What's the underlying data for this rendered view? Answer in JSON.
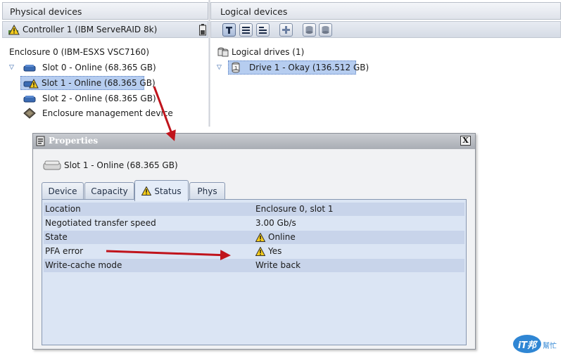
{
  "physical": {
    "header": "Physical devices",
    "controller": "Controller 1 (IBM ServeRAID 8k)",
    "enclosure": "Enclosure 0 (IBM-ESXS VSC7160)",
    "slots": [
      "Slot 0 - Online (68.365 GB)",
      "Slot 1 - Online (68.365 GB)",
      "Slot 2 - Online (68.365 GB)"
    ],
    "management": "Enclosure management device"
  },
  "logical": {
    "header": "Logical devices",
    "group": "Logical drives (1)",
    "drive": "Drive 1 - Okay (136.512 GB)"
  },
  "dialog": {
    "title": "Properties",
    "device": "Slot 1 - Online (68.365 GB)",
    "close": "X",
    "tabs": [
      "Device",
      "Capacity",
      "Status",
      "Phys"
    ],
    "active_tab": "Status",
    "rows": [
      {
        "key": "Location",
        "value": "Enclosure 0, slot 1"
      },
      {
        "key": "Negotiated transfer speed",
        "value": "3.00 Gb/s"
      },
      {
        "key": "State",
        "value": "Online"
      },
      {
        "key": "PFA error",
        "value": "Yes"
      },
      {
        "key": "Write-cache mode",
        "value": "Write back"
      }
    ]
  },
  "watermark": {
    "logo": "iT邦",
    "tag": "幫忙"
  },
  "icons": {
    "warning": "warning-icon",
    "hard_drive": "hard-drive-icon",
    "battery": "battery-icon",
    "chip": "chip-icon",
    "logical_drive": "logical-drive-icon"
  },
  "colors": {
    "selection": "#b6cdf0",
    "panel_blue": "#dbe5f4",
    "row_alt": "#c8d4ea",
    "arrow_red": "#c0141c",
    "warning_yellow": "#f5cc1c"
  }
}
